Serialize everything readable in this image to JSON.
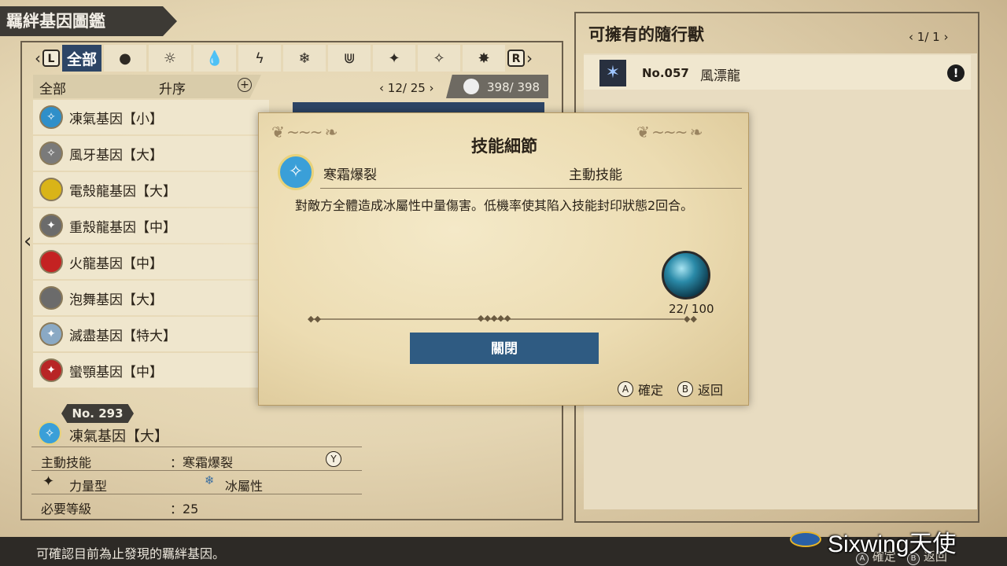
{
  "header": {
    "title": "羈絆基因圖鑑"
  },
  "tabs": {
    "left_key": "L",
    "right_key": "R",
    "items": [
      {
        "label": "全部",
        "icon": "all"
      },
      {
        "label": "●",
        "icon": "neutral-element-icon"
      },
      {
        "label": "☼",
        "icon": "fire-element-icon"
      },
      {
        "label": "💧",
        "icon": "water-element-icon"
      },
      {
        "label": "ϟ",
        "icon": "thunder-element-icon"
      },
      {
        "label": "❄",
        "icon": "ice-element-icon"
      },
      {
        "label": "⋓",
        "icon": "dragon-element-icon"
      },
      {
        "label": "✦",
        "icon": "power-type-icon"
      },
      {
        "label": "✧",
        "icon": "speed-type-icon"
      },
      {
        "label": "✸",
        "icon": "technique-type-icon"
      }
    ]
  },
  "subheader": {
    "filter": "全部",
    "sort": "升序",
    "page": "12/ 25",
    "count": "398/ 398"
  },
  "gene_list": [
    {
      "name": "凍氣基因【小】",
      "color": "#2f8fc9"
    },
    {
      "name": "風牙基因【大】",
      "color": "#7a7a7a"
    },
    {
      "name": "電殼龍基因【大】",
      "color": "#d9b418"
    },
    {
      "name": "重殼龍基因【中】",
      "color": "#6b6b6b"
    },
    {
      "name": "火龍基因【中】",
      "color": "#c42222"
    },
    {
      "name": "泡舞基因【大】",
      "color": "#6b6b6b"
    },
    {
      "name": "滅盡基因【特大】",
      "color": "#8aa9c4"
    },
    {
      "name": "蠻顎基因【中】",
      "color": "#b82525"
    }
  ],
  "detail": {
    "number": "No. 293",
    "name": "凍氣基因【大】",
    "active_skill_label": "主動技能",
    "active_skill_value": "：寒霜爆裂",
    "y_key": "Y",
    "type": "力量型",
    "element": "冰屬性",
    "level_label": "必要等級",
    "level_value": "：25"
  },
  "right_panel": {
    "title": "可擁有的隨行獸",
    "page": "1/  1",
    "monsters": [
      {
        "number": "No.057",
        "name": "風漂龍",
        "icon": "legiana-icon"
      }
    ]
  },
  "modal": {
    "title": "技能細節",
    "skill_name": "寒霜爆裂",
    "skill_type": "主動技能",
    "description": "對敵方全體造成冰屬性中量傷害。低機率使其陷入技能封印狀態2回合。",
    "cost": "22/ 100",
    "close_label": "關閉",
    "confirm_key": "A",
    "confirm_label": "確定",
    "back_key": "B",
    "back_label": "返回"
  },
  "footer": {
    "hint": "可確認目前為止發現的羈絆基因。",
    "confirm_key": "A",
    "confirm_label": "確定",
    "back_key": "B",
    "back_label": "返回",
    "watermark": "Sixwing天使"
  }
}
